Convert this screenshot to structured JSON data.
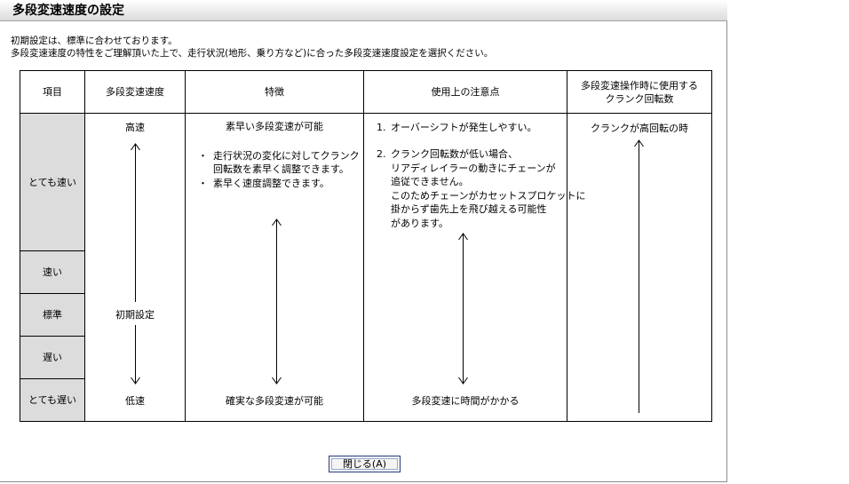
{
  "dialog": {
    "title": "多段変速速度の設定",
    "intro_line1": "初期設定は、標準に合わせております。",
    "intro_line2": "多段変速速度の特性をご理解頂いた上で、走行状況(地形、乗り方など)に合った多段変速速度設定を選択ください。"
  },
  "table": {
    "headers": {
      "item": "項目",
      "speed": "多段変速速度",
      "feature": "特徴",
      "caution": "使用上の注意点",
      "crank_line1": "多段変速操作時に使用する",
      "crank_line2": "クランク回転数"
    },
    "rows": {
      "very_fast": "とても速い",
      "fast": "速い",
      "standard": "標準",
      "slow": "遅い",
      "very_slow": "とても遅い"
    },
    "speed": {
      "high": "高速",
      "default": "初期設定",
      "low": "低速"
    },
    "feature": {
      "top": "素早い多段変速が可能",
      "bullet1_line1": "走行状況の変化に対してクランク",
      "bullet1_line2": "回転数を素早く調整できます。",
      "bullet2": "素早く速度調整できます。",
      "bottom": "確実な多段変速が可能",
      "bullet_mark": "・"
    },
    "caution": {
      "item1_num": "1.",
      "item1": "オーバーシフトが発生しやすい。",
      "item2_num": "2.",
      "item2_line1": "クランク回転数が低い場合、",
      "item2_line2": "リアディレイラーの動きにチェーンが",
      "item2_line3": "追従できません。",
      "item2_line4": "このためチェーンがカセットスプロケットに",
      "item2_line5": "掛からず歯先上を飛び越える可能性",
      "item2_line6": "があります。",
      "bottom": "多段変速に時間がかかる"
    },
    "crank": {
      "top": "クランクが高回転の時"
    }
  },
  "buttons": {
    "close": "閉じる(A)"
  }
}
